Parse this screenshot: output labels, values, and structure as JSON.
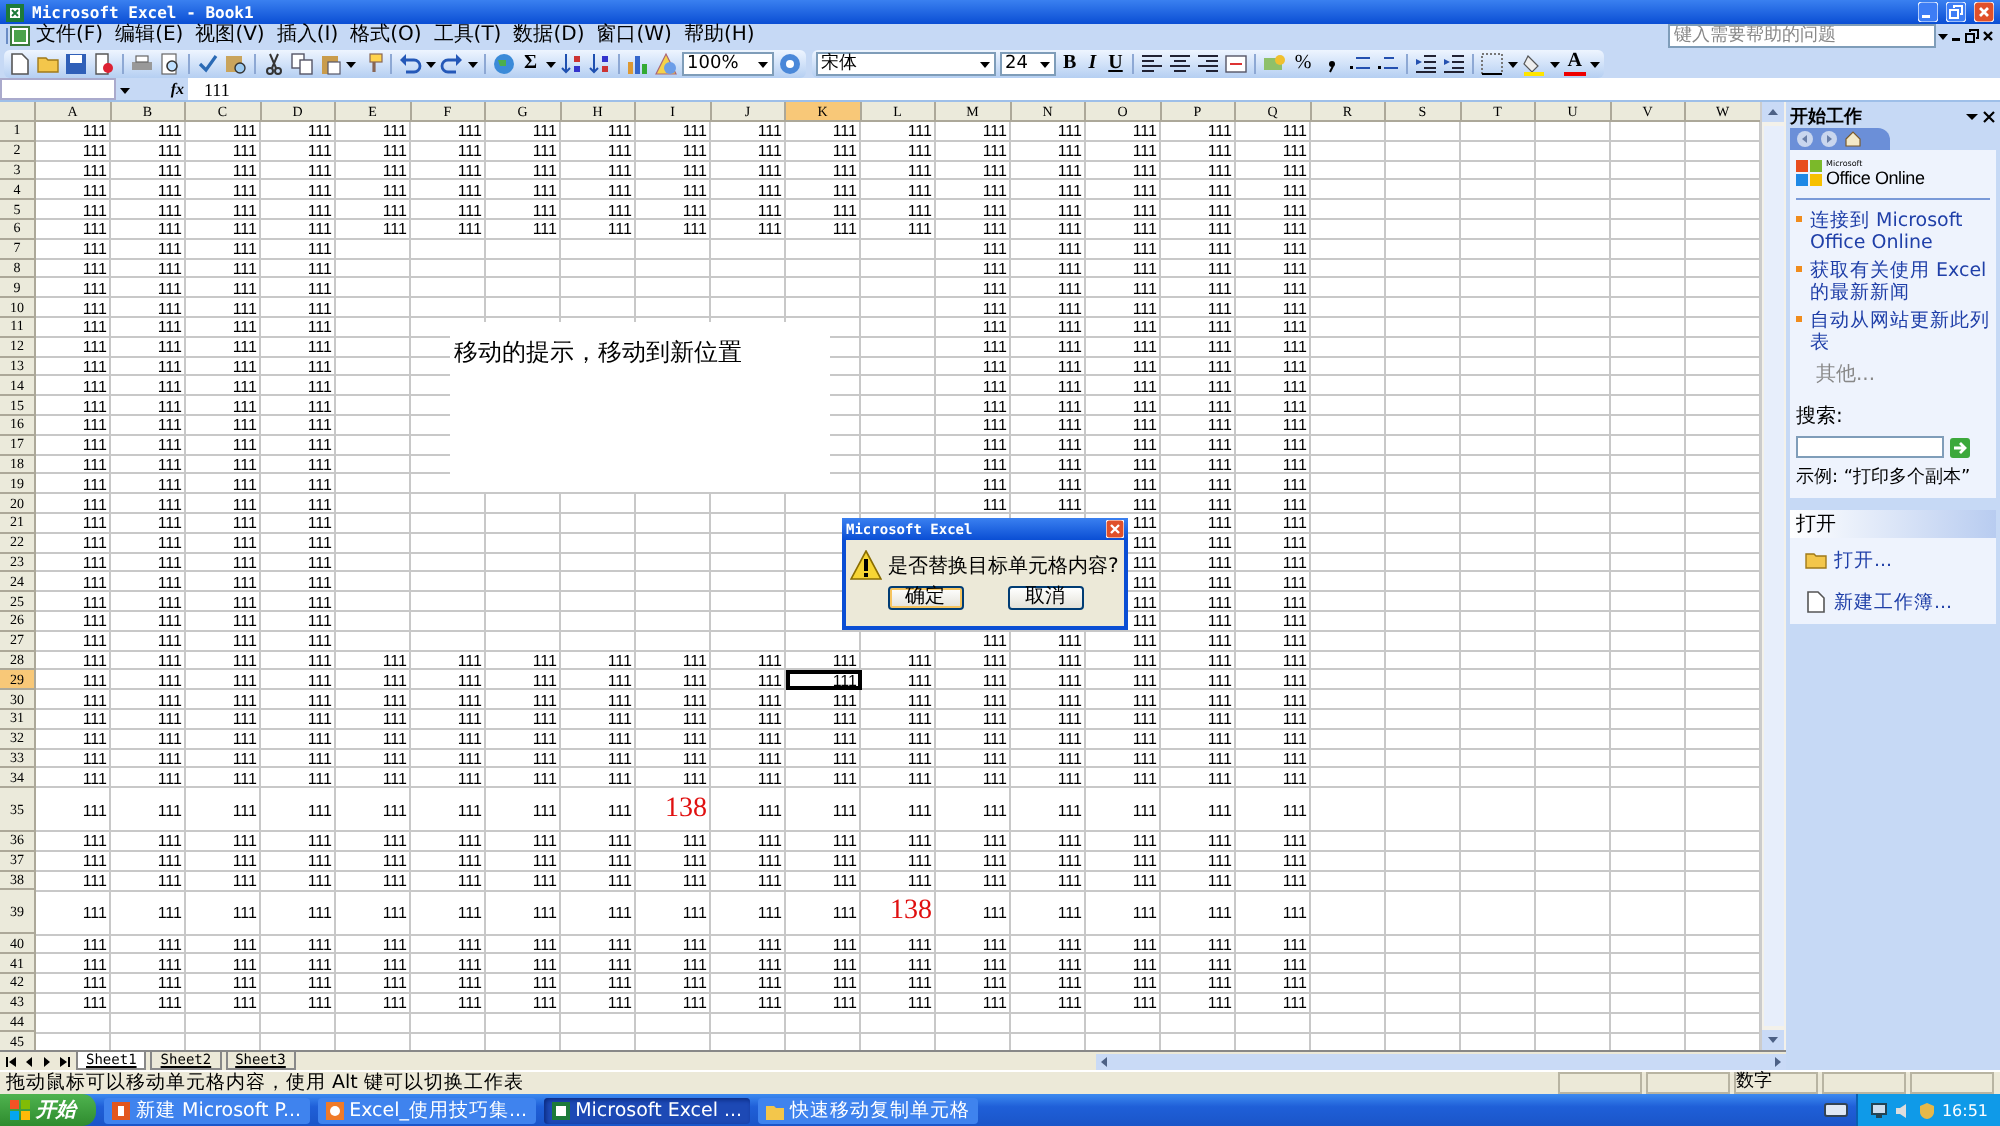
{
  "window": {
    "title": "Microsoft Excel - Book1"
  },
  "menu": [
    "文件(F)",
    "编辑(E)",
    "视图(V)",
    "插入(I)",
    "格式(O)",
    "工具(T)",
    "数据(D)",
    "窗口(W)",
    "帮助(H)"
  ],
  "help_box": {
    "placeholder": "键入需要帮助的问题"
  },
  "standard_toolbar": {
    "autosum": "Σ",
    "zoom": "100%"
  },
  "formatting_toolbar": {
    "font": "宋体",
    "size": "24",
    "bold": "B",
    "italic": "I",
    "underline": "U",
    "percent": "%",
    "font_color": "A"
  },
  "formula_bar": {
    "function_label": "fx",
    "value": "111"
  },
  "sheet": {
    "columns": [
      {
        "label": "A",
        "selected": false
      },
      {
        "label": "B",
        "selected": false
      },
      {
        "label": "C",
        "selected": false
      },
      {
        "label": "D",
        "selected": false
      },
      {
        "label": "E",
        "selected": false
      },
      {
        "label": "F",
        "selected": false
      },
      {
        "label": "G",
        "selected": false
      },
      {
        "label": "H",
        "selected": false
      },
      {
        "label": "I",
        "selected": false
      },
      {
        "label": "J",
        "selected": false
      },
      {
        "label": "K",
        "selected": true
      },
      {
        "label": "L",
        "selected": false
      },
      {
        "label": "M",
        "selected": false
      },
      {
        "label": "N",
        "selected": false
      },
      {
        "label": "O",
        "selected": false
      },
      {
        "label": "P",
        "selected": false
      },
      {
        "label": "Q",
        "selected": false
      },
      {
        "label": "R",
        "selected": false
      },
      {
        "label": "S",
        "selected": false
      },
      {
        "label": "T",
        "selected": false
      },
      {
        "label": "U",
        "selected": false
      },
      {
        "label": "V",
        "selected": false
      },
      {
        "label": "W",
        "selected": false
      }
    ],
    "rows": [
      {
        "label": "1",
        "selected": false,
        "cells": {
          "A": "111",
          "B": "111",
          "C": "111",
          "D": "111",
          "E": "111",
          "F": "111",
          "G": "111",
          "H": "111",
          "I": "111",
          "J": "111",
          "K": "111",
          "L": "111",
          "M": "111",
          "N": "111",
          "O": "111",
          "P": "111",
          "Q": "111"
        }
      },
      {
        "label": "2",
        "selected": false,
        "cells": {
          "A": "111",
          "B": "111",
          "C": "111",
          "D": "111",
          "E": "111",
          "F": "111",
          "G": "111",
          "H": "111",
          "I": "111",
          "J": "111",
          "K": "111",
          "L": "111",
          "M": "111",
          "N": "111",
          "O": "111",
          "P": "111",
          "Q": "111"
        }
      },
      {
        "label": "3",
        "selected": false,
        "cells": {
          "A": "111",
          "B": "111",
          "C": "111",
          "D": "111",
          "E": "111",
          "F": "111",
          "G": "111",
          "H": "111",
          "I": "111",
          "J": "111",
          "K": "111",
          "L": "111",
          "M": "111",
          "N": "111",
          "O": "111",
          "P": "111",
          "Q": "111"
        }
      },
      {
        "label": "4",
        "selected": false,
        "cells": {
          "A": "111",
          "B": "111",
          "C": "111",
          "D": "111",
          "E": "111",
          "F": "111",
          "G": "111",
          "H": "111",
          "I": "111",
          "J": "111",
          "K": "111",
          "L": "111",
          "M": "111",
          "N": "111",
          "O": "111",
          "P": "111",
          "Q": "111"
        }
      },
      {
        "label": "5",
        "selected": false,
        "cells": {
          "A": "111",
          "B": "111",
          "C": "111",
          "D": "111",
          "E": "111",
          "F": "111",
          "G": "111",
          "H": "111",
          "I": "111",
          "J": "111",
          "K": "111",
          "L": "111",
          "M": "111",
          "N": "111",
          "O": "111",
          "P": "111",
          "Q": "111"
        }
      },
      {
        "label": "6",
        "selected": false,
        "cells": {
          "A": "111",
          "B": "111",
          "C": "111",
          "D": "111",
          "E": "111",
          "F": "111",
          "G": "111",
          "H": "111",
          "I": "111",
          "J": "111",
          "K": "111",
          "L": "111",
          "M": "111",
          "N": "111",
          "O": "111",
          "P": "111",
          "Q": "111"
        }
      },
      {
        "label": "7",
        "selected": false,
        "cells": {
          "A": "111",
          "B": "111",
          "C": "111",
          "D": "111",
          "M": "111",
          "N": "111",
          "O": "111",
          "P": "111",
          "Q": "111"
        }
      },
      {
        "label": "8",
        "selected": false,
        "cells": {
          "A": "111",
          "B": "111",
          "C": "111",
          "D": "111",
          "M": "111",
          "N": "111",
          "O": "111",
          "P": "111",
          "Q": "111"
        }
      },
      {
        "label": "9",
        "selected": false,
        "cells": {
          "A": "111",
          "B": "111",
          "C": "111",
          "D": "111",
          "M": "111",
          "N": "111",
          "O": "111",
          "P": "111",
          "Q": "111"
        }
      },
      {
        "label": "10",
        "selected": false,
        "cells": {
          "A": "111",
          "B": "111",
          "C": "111",
          "D": "111",
          "M": "111",
          "N": "111",
          "O": "111",
          "P": "111",
          "Q": "111"
        }
      },
      {
        "label": "11",
        "selected": false,
        "cells": {
          "A": "111",
          "B": "111",
          "C": "111",
          "D": "111",
          "M": "111",
          "N": "111",
          "O": "111",
          "P": "111",
          "Q": "111"
        }
      },
      {
        "label": "12",
        "selected": false,
        "cells": {
          "A": "111",
          "B": "111",
          "C": "111",
          "D": "111",
          "M": "111",
          "N": "111",
          "O": "111",
          "P": "111",
          "Q": "111"
        }
      },
      {
        "label": "13",
        "selected": false,
        "cells": {
          "A": "111",
          "B": "111",
          "C": "111",
          "D": "111",
          "M": "111",
          "N": "111",
          "O": "111",
          "P": "111",
          "Q": "111"
        }
      },
      {
        "label": "14",
        "selected": false,
        "cells": {
          "A": "111",
          "B": "111",
          "C": "111",
          "D": "111",
          "M": "111",
          "N": "111",
          "O": "111",
          "P": "111",
          "Q": "111"
        }
      },
      {
        "label": "15",
        "selected": false,
        "cells": {
          "A": "111",
          "B": "111",
          "C": "111",
          "D": "111",
          "M": "111",
          "N": "111",
          "O": "111",
          "P": "111",
          "Q": "111"
        }
      },
      {
        "label": "16",
        "selected": false,
        "cells": {
          "A": "111",
          "B": "111",
          "C": "111",
          "D": "111",
          "M": "111",
          "N": "111",
          "O": "111",
          "P": "111",
          "Q": "111"
        }
      },
      {
        "label": "17",
        "selected": false,
        "cells": {
          "A": "111",
          "B": "111",
          "C": "111",
          "D": "111",
          "M": "111",
          "N": "111",
          "O": "111",
          "P": "111",
          "Q": "111"
        }
      },
      {
        "label": "18",
        "selected": false,
        "cells": {
          "A": "111",
          "B": "111",
          "C": "111",
          "D": "111",
          "M": "111",
          "N": "111",
          "O": "111",
          "P": "111",
          "Q": "111"
        }
      },
      {
        "label": "19",
        "selected": false,
        "cells": {
          "A": "111",
          "B": "111",
          "C": "111",
          "D": "111",
          "M": "111",
          "N": "111",
          "O": "111",
          "P": "111",
          "Q": "111"
        }
      },
      {
        "label": "20",
        "selected": false,
        "cells": {
          "A": "111",
          "B": "111",
          "C": "111",
          "D": "111",
          "M": "111",
          "N": "111",
          "O": "111",
          "P": "111",
          "Q": "111"
        }
      },
      {
        "label": "21",
        "selected": false,
        "cells": {
          "A": "111",
          "B": "111",
          "C": "111",
          "D": "111",
          "O": "111",
          "P": "111",
          "Q": "111"
        }
      },
      {
        "label": "22",
        "selected": false,
        "cells": {
          "A": "111",
          "B": "111",
          "C": "111",
          "D": "111",
          "O": "111",
          "P": "111",
          "Q": "111"
        }
      },
      {
        "label": "23",
        "selected": false,
        "cells": {
          "A": "111",
          "B": "111",
          "C": "111",
          "D": "111",
          "O": "111",
          "P": "111",
          "Q": "111"
        }
      },
      {
        "label": "24",
        "selected": false,
        "cells": {
          "A": "111",
          "B": "111",
          "C": "111",
          "D": "111",
          "O": "111",
          "P": "111",
          "Q": "111"
        }
      },
      {
        "label": "25",
        "selected": false,
        "cells": {
          "A": "111",
          "B": "111",
          "C": "111",
          "D": "111",
          "O": "111",
          "P": "111",
          "Q": "111"
        }
      },
      {
        "label": "26",
        "selected": false,
        "cells": {
          "A": "111",
          "B": "111",
          "C": "111",
          "D": "111",
          "O": "111",
          "P": "111",
          "Q": "111"
        }
      },
      {
        "label": "27",
        "selected": false,
        "cells": {
          "A": "111",
          "B": "111",
          "C": "111",
          "D": "111",
          "M": "111",
          "N": "111",
          "O": "111",
          "P": "111",
          "Q": "111"
        }
      },
      {
        "label": "28",
        "selected": false,
        "cells": {
          "A": "111",
          "B": "111",
          "C": "111",
          "D": "111",
          "E": "111",
          "F": "111",
          "G": "111",
          "H": "111",
          "I": "111",
          "J": "111",
          "K": "111",
          "L": "111",
          "M": "111",
          "N": "111",
          "O": "111",
          "P": "111",
          "Q": "111"
        }
      },
      {
        "label": "29",
        "selected": true,
        "cells": {
          "A": "111",
          "B": "111",
          "C": "111",
          "D": "111",
          "E": "111",
          "F": "111",
          "G": "111",
          "H": "111",
          "I": "111",
          "J": "111",
          "K": "111",
          "L": "111",
          "M": "111",
          "N": "111",
          "O": "111",
          "P": "111",
          "Q": "111"
        }
      },
      {
        "label": "30",
        "selected": false,
        "cells": {
          "A": "111",
          "B": "111",
          "C": "111",
          "D": "111",
          "E": "111",
          "F": "111",
          "G": "111",
          "H": "111",
          "I": "111",
          "J": "111",
          "K": "111",
          "L": "111",
          "M": "111",
          "N": "111",
          "O": "111",
          "P": "111",
          "Q": "111"
        }
      },
      {
        "label": "31",
        "selected": false,
        "cells": {
          "A": "111",
          "B": "111",
          "C": "111",
          "D": "111",
          "E": "111",
          "F": "111",
          "G": "111",
          "H": "111",
          "I": "111",
          "J": "111",
          "K": "111",
          "L": "111",
          "M": "111",
          "N": "111",
          "O": "111",
          "P": "111",
          "Q": "111"
        }
      },
      {
        "label": "32",
        "selected": false,
        "cells": {
          "A": "111",
          "B": "111",
          "C": "111",
          "D": "111",
          "E": "111",
          "F": "111",
          "G": "111",
          "H": "111",
          "I": "111",
          "J": "111",
          "K": "111",
          "L": "111",
          "M": "111",
          "N": "111",
          "O": "111",
          "P": "111",
          "Q": "111"
        }
      },
      {
        "label": "33",
        "selected": false,
        "cells": {
          "A": "111",
          "B": "111",
          "C": "111",
          "D": "111",
          "E": "111",
          "F": "111",
          "G": "111",
          "H": "111",
          "I": "111",
          "J": "111",
          "K": "111",
          "L": "111",
          "M": "111",
          "N": "111",
          "O": "111",
          "P": "111",
          "Q": "111"
        }
      },
      {
        "label": "34",
        "selected": false,
        "cells": {
          "A": "111",
          "B": "111",
          "C": "111",
          "D": "111",
          "E": "111",
          "F": "111",
          "G": "111",
          "H": "111",
          "I": "111",
          "J": "111",
          "K": "111",
          "L": "111",
          "M": "111",
          "N": "111",
          "O": "111",
          "P": "111",
          "Q": "111"
        }
      },
      {
        "label": "35",
        "selected": false,
        "cells": {
          "A": "111",
          "B": "111",
          "C": "111",
          "D": "111",
          "E": "111",
          "F": "111",
          "G": "111",
          "H": "111",
          "I": {
            "text": "138",
            "large": true
          },
          "J": "111",
          "K": "111",
          "L": "111",
          "M": "111",
          "N": "111",
          "O": "111",
          "P": "111",
          "Q": "111"
        }
      },
      {
        "label": "36",
        "selected": false,
        "cells": {
          "A": "111",
          "B": "111",
          "C": "111",
          "D": "111",
          "E": "111",
          "F": "111",
          "G": "111",
          "H": "111",
          "I": "111",
          "J": "111",
          "K": "111",
          "L": "111",
          "M": "111",
          "N": "111",
          "O": "111",
          "P": "111",
          "Q": "111"
        }
      },
      {
        "label": "37",
        "selected": false,
        "cells": {
          "A": "111",
          "B": "111",
          "C": "111",
          "D": "111",
          "E": "111",
          "F": "111",
          "G": "111",
          "H": "111",
          "I": "111",
          "J": "111",
          "K": "111",
          "L": "111",
          "M": "111",
          "N": "111",
          "O": "111",
          "P": "111",
          "Q": "111"
        }
      },
      {
        "label": "38",
        "selected": false,
        "cells": {
          "A": "111",
          "B": "111",
          "C": "111",
          "D": "111",
          "E": "111",
          "F": "111",
          "G": "111",
          "H": "111",
          "I": "111",
          "J": "111",
          "K": "111",
          "L": "111",
          "M": "111",
          "N": "111",
          "O": "111",
          "P": "111",
          "Q": "111"
        }
      },
      {
        "label": "39",
        "selected": false,
        "cells": {
          "A": "111",
          "B": "111",
          "C": "111",
          "D": "111",
          "E": "111",
          "F": "111",
          "G": "111",
          "H": "111",
          "I": "111",
          "J": "111",
          "K": "111",
          "L": {
            "text": "138",
            "large": true
          },
          "M": "111",
          "N": "111",
          "O": "111",
          "P": "111",
          "Q": "111"
        }
      },
      {
        "label": "40",
        "selected": false,
        "cells": {
          "A": "111",
          "B": "111",
          "C": "111",
          "D": "111",
          "E": "111",
          "F": "111",
          "G": "111",
          "H": "111",
          "I": "111",
          "J": "111",
          "K": "111",
          "L": "111",
          "M": "111",
          "N": "111",
          "O": "111",
          "P": "111",
          "Q": "111"
        }
      },
      {
        "label": "41",
        "selected": false,
        "cells": {
          "A": "111",
          "B": "111",
          "C": "111",
          "D": "111",
          "E": "111",
          "F": "111",
          "G": "111",
          "H": "111",
          "I": "111",
          "J": "111",
          "K": "111",
          "L": "111",
          "M": "111",
          "N": "111",
          "O": "111",
          "P": "111",
          "Q": "111"
        }
      },
      {
        "label": "42",
        "selected": false,
        "cells": {
          "A": "111",
          "B": "111",
          "C": "111",
          "D": "111",
          "E": "111",
          "F": "111",
          "G": "111",
          "H": "111",
          "I": "111",
          "J": "111",
          "K": "111",
          "L": "111",
          "M": "111",
          "N": "111",
          "O": "111",
          "P": "111",
          "Q": "111"
        }
      },
      {
        "label": "43",
        "selected": false,
        "cells": {
          "A": "111",
          "B": "111",
          "C": "111",
          "D": "111",
          "E": "111",
          "F": "111",
          "G": "111",
          "H": "111",
          "I": "111",
          "J": "111",
          "K": "111",
          "L": "111",
          "M": "111",
          "N": "111",
          "O": "111",
          "P": "111",
          "Q": "111"
        }
      },
      {
        "label": "44",
        "selected": false
      },
      {
        "label": "45",
        "selected": false
      }
    ],
    "text_box": "移动的提示，移动到新位置",
    "tabs": [
      {
        "label": "Sheet1",
        "selected": true
      },
      {
        "label": "Sheet2",
        "selected": false
      },
      {
        "label": "Sheet3",
        "selected": false
      }
    ]
  },
  "dialog": {
    "title": "Microsoft Excel",
    "message": "是否替换目标单元格内容?",
    "buttons": [
      "确定",
      "取消"
    ]
  },
  "task_pane": {
    "title": "开始工作",
    "brand_small": "Microsoft",
    "brand": "Office Online",
    "links": [
      "连接到 Microsoft Office Online",
      "获取有关使用 Excel 的最新新闻",
      "自动从网站更新此列表"
    ],
    "more": "其他...",
    "search_label": "搜索:",
    "example": "示例:  “打印多个副本”",
    "open_section": "打开",
    "open_items": [
      "打开...",
      "新建工作簿..."
    ]
  },
  "status_bar": {
    "message": "拖动鼠标可以移动单元格内容，使用 Alt 键可以切换工作表",
    "mode": "数字"
  },
  "taskbar": {
    "start": "开始",
    "tasks": [
      {
        "label": "新建 Microsoft P...",
        "selected": false
      },
      {
        "label": "Excel_使用技巧集...",
        "selected": false
      },
      {
        "label": "Microsoft Excel ...",
        "selected": true
      },
      {
        "label": "快速移动复制单元格",
        "selected": false
      }
    ],
    "clock": "16:51"
  }
}
